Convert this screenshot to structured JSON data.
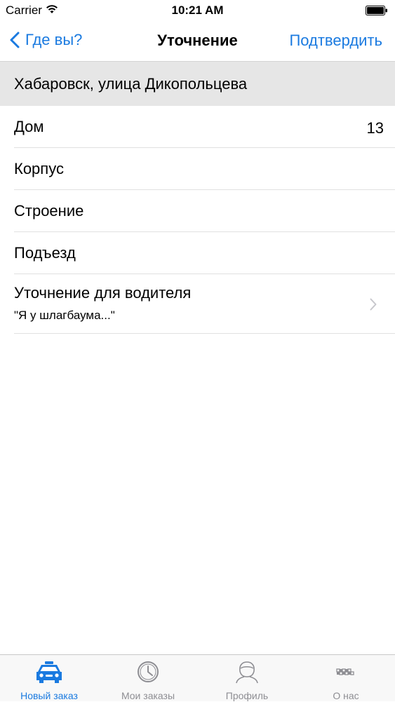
{
  "status_bar": {
    "carrier": "Carrier",
    "time": "10:21 AM"
  },
  "nav": {
    "back_label": "Где вы?",
    "title": "Уточнение",
    "confirm_label": "Подтвердить"
  },
  "address": "Хабаровск, улица Дикопольцева",
  "fields": [
    {
      "label": "Дом",
      "value": "13"
    },
    {
      "label": "Корпус",
      "value": ""
    },
    {
      "label": "Строение",
      "value": ""
    },
    {
      "label": "Подъезд",
      "value": ""
    }
  ],
  "driver_note": {
    "label": "Уточнение для водителя",
    "placeholder": "\"Я у шлагбаума...\""
  },
  "tabs": [
    {
      "label": "Новый заказ",
      "icon": "taxi-car-icon",
      "active": true
    },
    {
      "label": "Мои заказы",
      "icon": "clock-icon",
      "active": false
    },
    {
      "label": "Профиль",
      "icon": "person-icon",
      "active": false
    },
    {
      "label": "О нас",
      "icon": "checkered-icon",
      "active": false
    }
  ],
  "colors": {
    "accent": "#1a7ae0",
    "header_bg": "#e6e6e6",
    "inactive_tab": "#8e8e93"
  }
}
